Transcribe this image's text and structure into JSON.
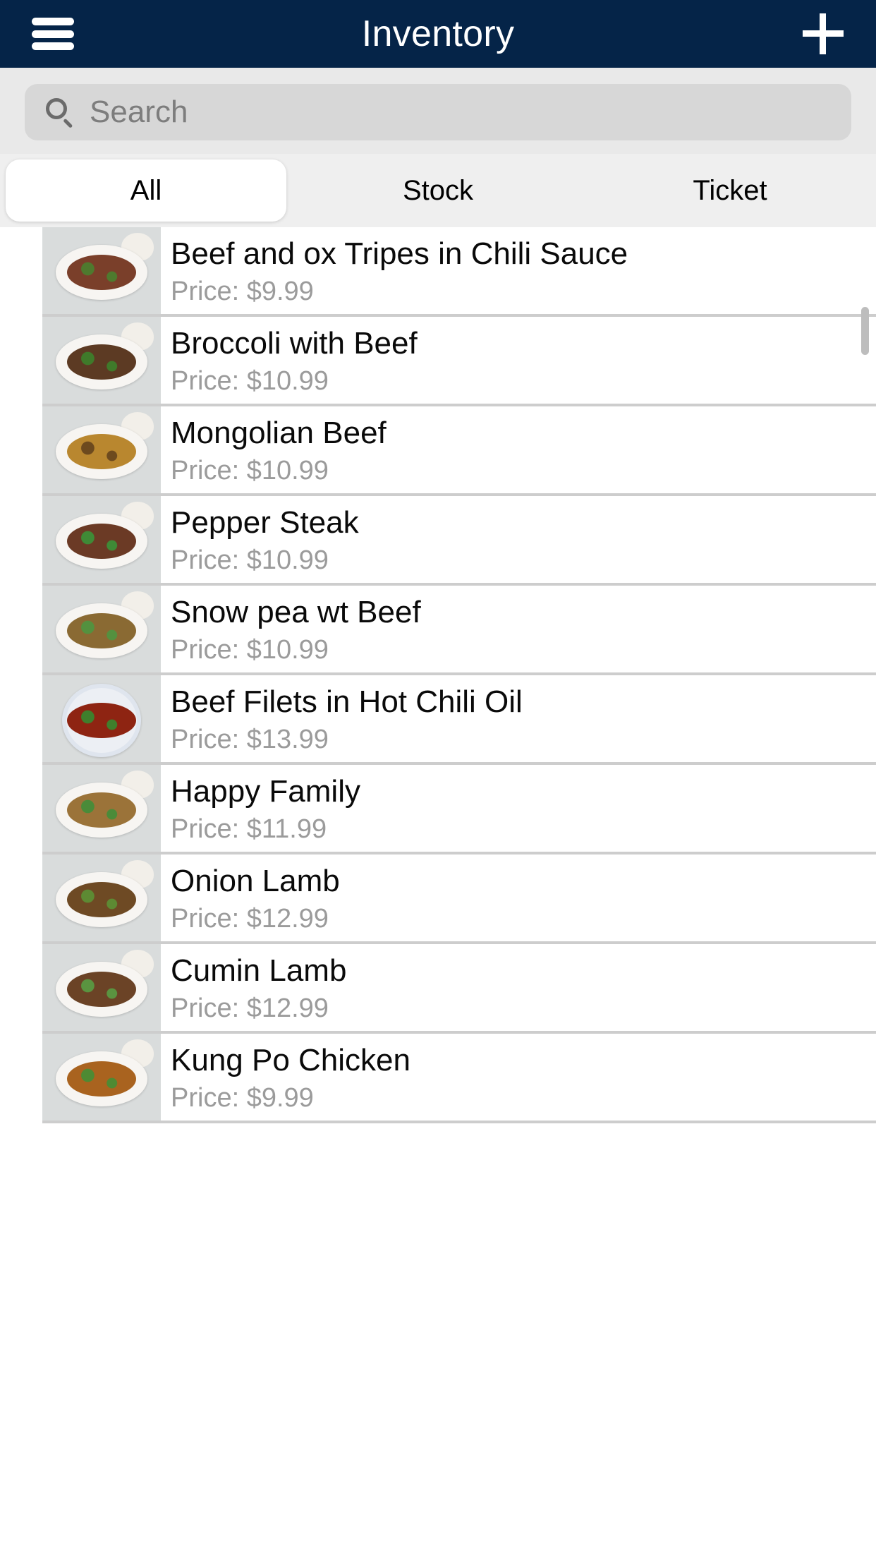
{
  "header": {
    "title": "Inventory",
    "menu_icon": "hamburger-menu-icon",
    "add_icon": "plus-icon",
    "background_color": "#052448"
  },
  "search": {
    "placeholder": "Search",
    "value": "",
    "icon": "search-icon"
  },
  "segmented_control": {
    "selected": "All",
    "options": [
      {
        "label": "All",
        "selected": true
      },
      {
        "label": "Stock",
        "selected": false
      },
      {
        "label": "Ticket",
        "selected": false
      }
    ]
  },
  "list": {
    "price_prefix": "Price: ",
    "items": [
      {
        "name": "Beef and ox Tripes in Chili Sauce",
        "price": "Price: $9.99",
        "image": "plate-of-beef-and-ox-tripes",
        "style": "plate",
        "food_color": "#7a3f2a",
        "garnish": "#4e7a2e"
      },
      {
        "name": "Broccoli with Beef",
        "price": "Price: $10.99",
        "image": "plate-of-broccoli-with-beef",
        "style": "plate",
        "food_color": "#5c3a23",
        "garnish": "#3f7a2a"
      },
      {
        "name": "Mongolian Beef",
        "price": "Price: $10.99",
        "image": "plate-of-mongolian-beef",
        "style": "plate",
        "food_color": "#b9872f",
        "garnish": "#6d4a1e"
      },
      {
        "name": "Pepper Steak",
        "price": "Price: $10.99",
        "image": "plate-of-pepper-steak",
        "style": "plate",
        "food_color": "#6b3a25",
        "garnish": "#3f8a36"
      },
      {
        "name": "Snow pea wt Beef",
        "price": "Price: $10.99",
        "image": "plate-of-snow-pea-with-beef",
        "style": "plate",
        "food_color": "#8a6a33",
        "garnish": "#54913f"
      },
      {
        "name": "Beef Filets in Hot Chili Oil",
        "price": "Price: $13.99",
        "image": "bowl-of-beef-filets-in-hot-chili-oil",
        "style": "bowl",
        "food_color": "#8e2412",
        "garnish": "#3f7f2c"
      },
      {
        "name": "Happy Family",
        "price": "Price: $11.99",
        "image": "plate-of-happy-family",
        "style": "plate",
        "food_color": "#9b7339",
        "garnish": "#4a8b39"
      },
      {
        "name": "Onion Lamb",
        "price": "Price: $12.99",
        "image": "plate-of-onion-lamb",
        "style": "plate",
        "food_color": "#6e4a24",
        "garnish": "#5d8a33"
      },
      {
        "name": "Cumin Lamb",
        "price": "Price: $12.99",
        "image": "plate-of-cumin-lamb",
        "style": "plate",
        "food_color": "#6b4326",
        "garnish": "#5a9440"
      },
      {
        "name": "Kung Po Chicken",
        "price": "Price: $9.99",
        "image": "plate-of-kung-po-chicken",
        "style": "plate",
        "food_color": "#a9631f",
        "garnish": "#4e8a33"
      }
    ]
  },
  "scrollbar": {
    "visible": true
  }
}
